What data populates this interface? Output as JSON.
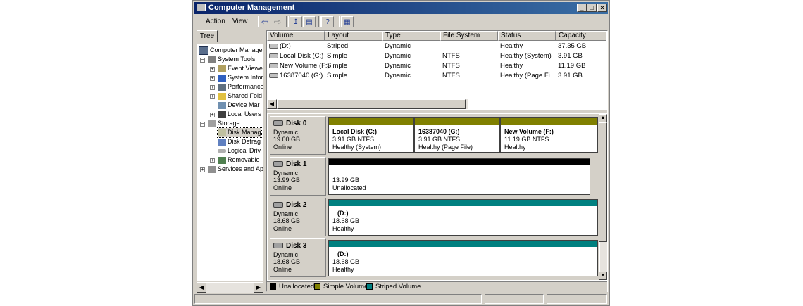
{
  "window": {
    "title": "Computer Management"
  },
  "menu": {
    "action": "Action",
    "view": "View"
  },
  "tree": {
    "tab": "Tree",
    "items": [
      {
        "label": "Computer Managem",
        "level": 0
      },
      {
        "label": "System Tools",
        "level": 1
      },
      {
        "label": "Event Viewe",
        "level": 2
      },
      {
        "label": "System Infor",
        "level": 2
      },
      {
        "label": "Performance",
        "level": 2
      },
      {
        "label": "Shared Fold",
        "level": 2
      },
      {
        "label": "Device Mar",
        "level": 2
      },
      {
        "label": "Local Users",
        "level": 2
      },
      {
        "label": "Storage",
        "level": 1
      },
      {
        "label": "Disk Manag",
        "level": 2
      },
      {
        "label": "Disk Defrag",
        "level": 2
      },
      {
        "label": "Logical Driv",
        "level": 2
      },
      {
        "label": "Removable",
        "level": 2
      },
      {
        "label": "Services and Ap",
        "level": 1
      }
    ]
  },
  "volumes": {
    "headers": [
      "Volume",
      "Layout",
      "Type",
      "File System",
      "Status",
      "Capacity"
    ],
    "rows": [
      {
        "volume": "(D:)",
        "layout": "Striped",
        "type": "Dynamic",
        "fs": "",
        "status": "Healthy",
        "capacity": "37.35 GB"
      },
      {
        "volume": "Local Disk (C:)",
        "layout": "Simple",
        "type": "Dynamic",
        "fs": "NTFS",
        "status": "Healthy (System)",
        "capacity": "3.91 GB"
      },
      {
        "volume": "New Volume (F:)",
        "layout": "Simple",
        "type": "Dynamic",
        "fs": "NTFS",
        "status": "Healthy",
        "capacity": "11.19 GB"
      },
      {
        "volume": "16387040 (G:)",
        "layout": "Simple",
        "type": "Dynamic",
        "fs": "NTFS",
        "status": "Healthy (Page Fi...",
        "capacity": "3.91 GB"
      }
    ]
  },
  "disks": [
    {
      "name": "Disk 0",
      "type": "Dynamic",
      "size": "19.00 GB",
      "state": "Online",
      "parts": [
        {
          "title": "Local Disk (C:)",
          "detail": "3.91 GB NTFS",
          "status": "Healthy (System)"
        },
        {
          "title": "16387040 (G:)",
          "detail": "3.91 GB NTFS",
          "status": "Healthy (Page File)"
        },
        {
          "title": "New Volume (F:)",
          "detail": "11.19 GB NTFS",
          "status": "Healthy"
        }
      ]
    },
    {
      "name": "Disk 1",
      "type": "Dynamic",
      "size": "13.99 GB",
      "state": "Online",
      "parts": [
        {
          "title": "",
          "detail": "13.99 GB",
          "status": "Unallocated"
        }
      ]
    },
    {
      "name": "Disk 2",
      "type": "Dynamic",
      "size": "18.68 GB",
      "state": "Online",
      "parts": [
        {
          "title": "(D:)",
          "detail": "18.68 GB",
          "status": "Healthy"
        }
      ]
    },
    {
      "name": "Disk 3",
      "type": "Dynamic",
      "size": "18.68 GB",
      "state": "Online",
      "parts": [
        {
          "title": "(D:)",
          "detail": "18.68 GB",
          "status": "Healthy"
        }
      ]
    }
  ],
  "legend": {
    "unallocated": "Unallocated",
    "simple": "Simple Volume",
    "striped": "Striped Volume"
  },
  "colors": {
    "simple": "#808000",
    "striped": "#008080",
    "unallocated": "#000000",
    "title_bar": "#0a246a"
  }
}
